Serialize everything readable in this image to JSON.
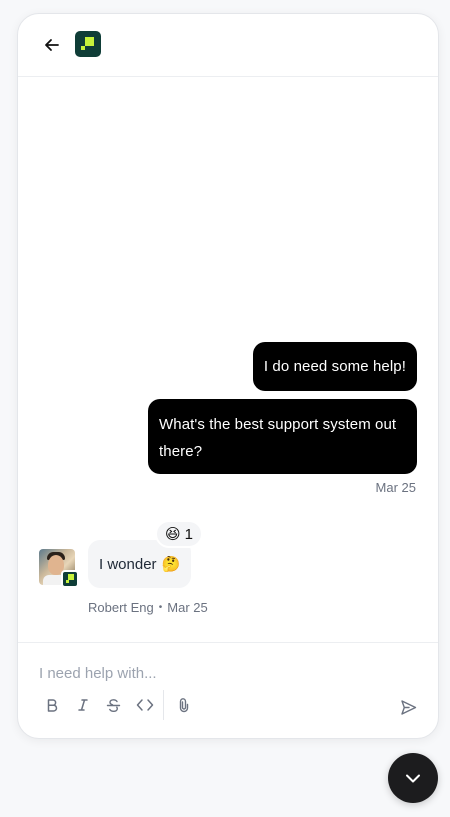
{
  "header": {
    "back_icon": "arrow-left-icon",
    "logo": "brand-logo"
  },
  "messages": [
    {
      "from": "user",
      "text": "I do need some help!"
    },
    {
      "from": "user",
      "text": "What's the best support system out there?",
      "date": "Mar 25"
    },
    {
      "from": "agent",
      "text": "I wonder",
      "emoji": "🤔",
      "author": "Robert Eng",
      "separator": "•",
      "date": "Mar 25",
      "reaction": {
        "emoji": "😆",
        "count": "1"
      }
    }
  ],
  "composer": {
    "placeholder": "I need help with...",
    "value": "",
    "tools": [
      "bold-icon",
      "italic-icon",
      "strikethrough-icon",
      "code-icon",
      "attachment-icon"
    ],
    "send_icon": "send-icon"
  },
  "launcher": {
    "icon": "chevron-down-icon"
  },
  "colors": {
    "brand_dark": "#0f3d37",
    "brand_accent": "#c6f23b",
    "user_bubble": "#000000",
    "agent_bubble": "#f4f5f7",
    "launcher": "#1c1c1e"
  }
}
